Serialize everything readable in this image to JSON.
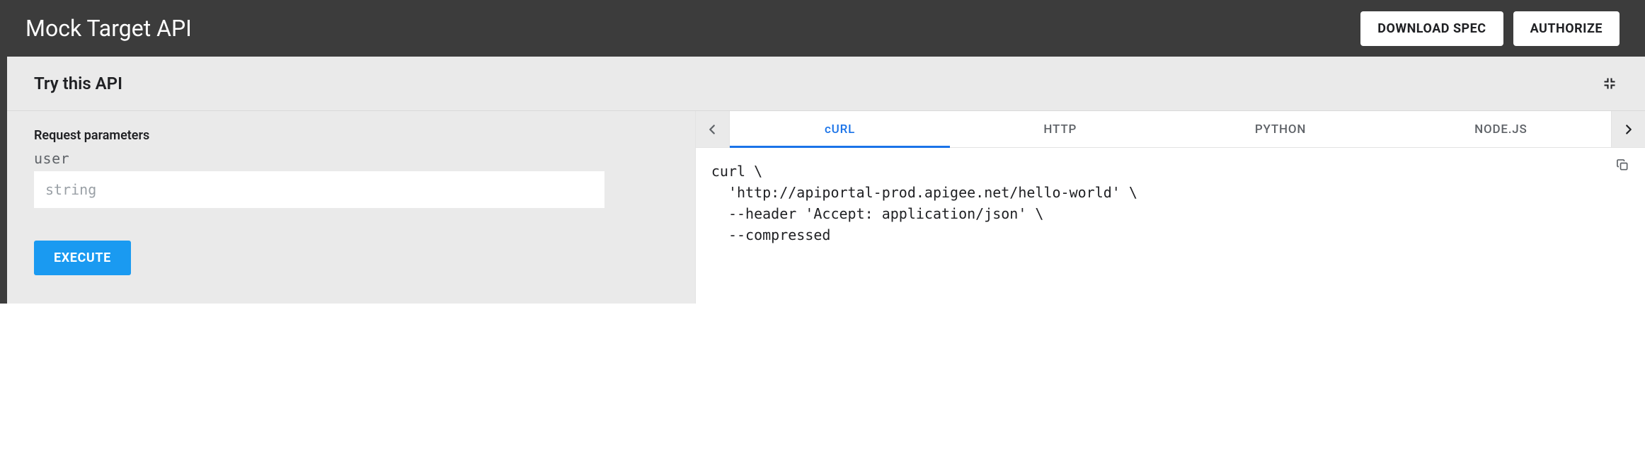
{
  "header": {
    "title": "Mock Target API",
    "download_label": "DOWNLOAD SPEC",
    "authorize_label": "AUTHORIZE"
  },
  "panel": {
    "title": "Try this API"
  },
  "request": {
    "heading": "Request parameters",
    "params": [
      {
        "name": "user",
        "placeholder": "string"
      }
    ],
    "execute_label": "EXECUTE"
  },
  "code": {
    "tabs": [
      "cURL",
      "HTTP",
      "PYTHON",
      "NODE.JS"
    ],
    "active_tab": 0,
    "snippet": "curl \\\n  'http://apiportal-prod.apigee.net/hello-world' \\\n  --header 'Accept: application/json' \\\n  --compressed"
  }
}
